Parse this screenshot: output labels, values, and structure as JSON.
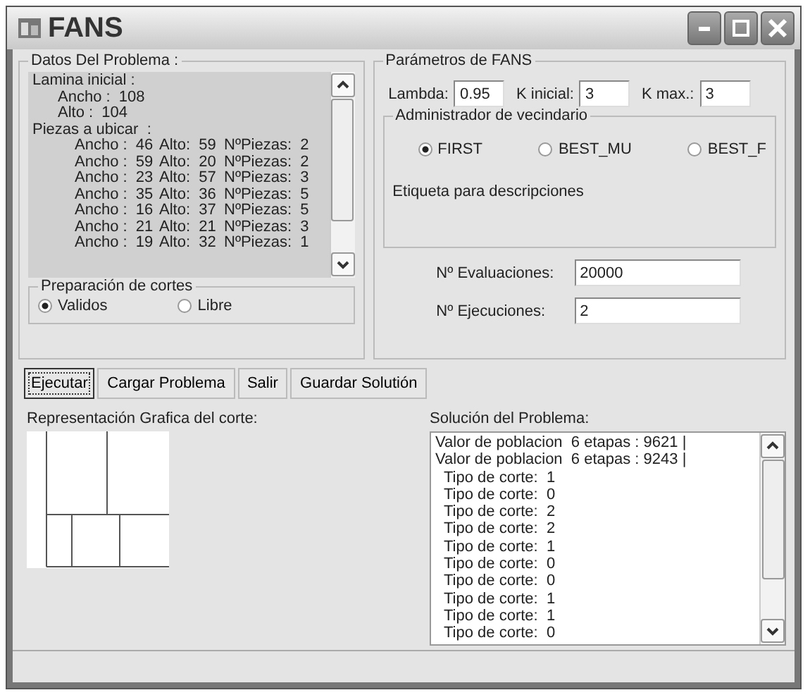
{
  "window": {
    "title": "FANS"
  },
  "datos": {
    "title": "Datos Del Problema :",
    "lamina": {
      "text": "Lamina inicial :",
      "children": [
        {
          "text": "Ancho :  108"
        },
        {
          "text": "Alto :  104"
        }
      ]
    },
    "piezas_title": "Piezas a ubicar  :",
    "piezas": [
      {
        "ancho": "Ancho :  46",
        "alto": "Alto:  59",
        "n": "NºPiezas:  2"
      },
      {
        "ancho": "Ancho :  59",
        "alto": "Alto:  20",
        "n": "NºPiezas:  2"
      },
      {
        "ancho": "Ancho :  23",
        "alto": "Alto:  57",
        "n": "NºPiezas:  3"
      },
      {
        "ancho": "Ancho :  35",
        "alto": "Alto:  36",
        "n": "NºPiezas:  5"
      },
      {
        "ancho": "Ancho :  16",
        "alto": "Alto:  37",
        "n": "NºPiezas:  5"
      },
      {
        "ancho": "Ancho :  21",
        "alto": "Alto:  21",
        "n": "NºPiezas:  3"
      },
      {
        "ancho": "Ancho :  19",
        "alto": "Alto:  32",
        "n": "NºPiezas:  1"
      }
    ]
  },
  "preparacion": {
    "title": "Preparación de cortes",
    "options": [
      {
        "label": "Validos",
        "selected": true
      },
      {
        "label": "Libre",
        "selected": false
      }
    ]
  },
  "buttons": [
    {
      "label": "Ejecutar",
      "focused": true
    },
    {
      "label": "Cargar Problema",
      "focused": false
    },
    {
      "label": "Salir",
      "focused": false
    },
    {
      "label": "Guardar Solutión",
      "focused": false
    }
  ],
  "representacion": {
    "title": "Representación Grafica del corte:"
  },
  "parametros": {
    "title": "Parámetros de FANS",
    "fields": [
      {
        "label": "Lambda:",
        "value": "0.95"
      },
      {
        "label": "K inicial:",
        "value": "3"
      },
      {
        "label": "K max.:",
        "value": "3"
      }
    ],
    "vecindario": {
      "title": "Administrador de vecindario",
      "options": [
        {
          "label": "FIRST",
          "selected": true
        },
        {
          "label": "BEST_MU",
          "selected": false
        },
        {
          "label": "BEST_F",
          "selected": false
        }
      ],
      "description": "Etiqueta para descripciones"
    },
    "counts": [
      {
        "label": "Nº Evaluaciones:",
        "value": "20000"
      },
      {
        "label": "Nº Ejecuciones:",
        "value": "2"
      }
    ]
  },
  "solucion": {
    "title": "Solución del Problema:",
    "lines": [
      {
        "kind": "value",
        "text": "Valor de poblacion  6 etapas : 9621 |"
      },
      {
        "kind": "value",
        "text": "Valor de poblacion  6 etapas : 9243 |"
      },
      {
        "kind": "cut",
        "text": "Tipo de corte:  1"
      },
      {
        "kind": "cut",
        "text": "Tipo de corte:  0"
      },
      {
        "kind": "cut",
        "text": "Tipo de corte:  2"
      },
      {
        "kind": "cut",
        "text": "Tipo de corte:  2"
      },
      {
        "kind": "cut",
        "text": "Tipo de corte:  1"
      },
      {
        "kind": "cut",
        "text": "Tipo de corte:  0"
      },
      {
        "kind": "cut",
        "text": "Tipo de corte:  0"
      },
      {
        "kind": "cut",
        "text": "Tipo de corte:  1"
      },
      {
        "kind": "cut",
        "text": "Tipo de corte:  1"
      },
      {
        "kind": "cut",
        "text": "Tipo de corte:  0"
      }
    ]
  }
}
